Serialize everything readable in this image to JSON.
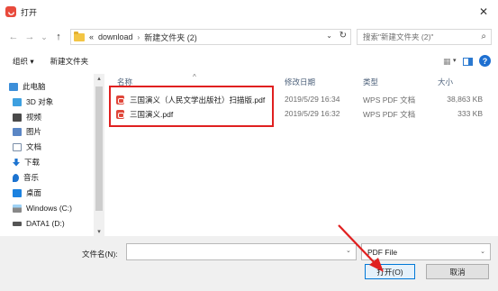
{
  "window": {
    "title": "打开",
    "close_glyph": "✕",
    "app_icon": "wps-logo-icon"
  },
  "nav": {
    "back_glyph": "←",
    "forward_glyph": "→",
    "recent_glyph": "⌄",
    "up_glyph": "↑",
    "overflow": "«",
    "crumbs": [
      "download",
      "新建文件夹 (2)"
    ],
    "crumb_sep": "›",
    "dropdown_glyph": "⌄",
    "refresh_glyph": "↻",
    "search_placeholder": "搜索\"新建文件夹 (2)\"",
    "search_glyph": "⌕"
  },
  "toolbar": {
    "organize": "组织 ▾",
    "new_folder": "新建文件夹",
    "view_glyph": "▦",
    "view_drop": "▾",
    "help": "?"
  },
  "sidebar": {
    "items": [
      {
        "label": "此电脑",
        "icon": "computer-icon",
        "color": "#3d8fd9"
      },
      {
        "label": "3D 对象",
        "icon": "cube-icon",
        "color": "#3da0e0"
      },
      {
        "label": "视频",
        "icon": "video-icon",
        "color": "#4a4a4a"
      },
      {
        "label": "图片",
        "icon": "picture-icon",
        "color": "#5a86c5"
      },
      {
        "label": "文档",
        "icon": "document-icon",
        "color": "#7a8ea8"
      },
      {
        "label": "下载",
        "icon": "download-icon",
        "color": "#1c73d0"
      },
      {
        "label": "音乐",
        "icon": "music-icon",
        "color": "#1c73d0"
      },
      {
        "label": "桌面",
        "icon": "desktop-icon",
        "color": "#1c82e0"
      },
      {
        "label": "Windows (C:)",
        "icon": "windows-drive-icon",
        "color": "#3a9ad9"
      },
      {
        "label": "DATA1 (D:)",
        "icon": "drive-icon",
        "color": "#555555"
      }
    ],
    "scroll_up": "▴",
    "scroll_down": "▾"
  },
  "filelist": {
    "columns": {
      "name": "名称",
      "date": "修改日期",
      "type": "类型",
      "size": "大小"
    },
    "sort_glyph": "^",
    "rows": [
      {
        "name": "三国演义（人民文学出版社）扫描版.pdf",
        "date": "2019/5/29 16:34",
        "type": "WPS PDF 文档",
        "size": "38,863 KB"
      },
      {
        "name": "三国演义.pdf",
        "date": "2019/5/29 16:32",
        "type": "WPS PDF 文档",
        "size": "333 KB"
      }
    ]
  },
  "footer": {
    "filename_label": "文件名(N):",
    "filename_value": "",
    "filename_drop": "⌄",
    "filetype_value": "PDF File",
    "filetype_drop": "⌄",
    "open_label": "打开(O)",
    "cancel_label": "取消"
  },
  "colors": {
    "annotation": "#e02020",
    "accent": "#0078d7"
  }
}
